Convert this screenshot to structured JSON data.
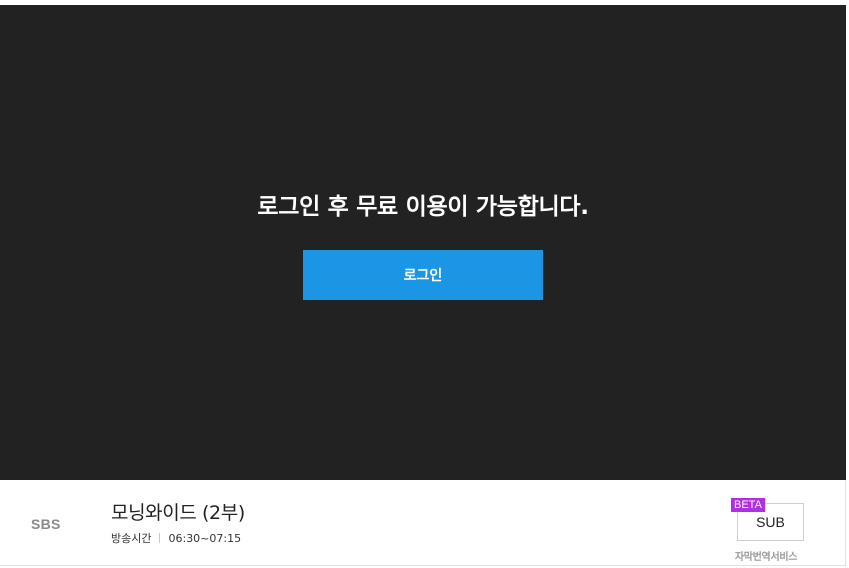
{
  "player": {
    "login_message": "로그인 후 무료 이용이 가능합니다.",
    "login_button_label": "로그인",
    "background_color": "#222222",
    "button_color": "#1b96e5"
  },
  "program": {
    "channel": "SBS",
    "title": "모닝와이드 (2부)",
    "airtime_label": "방송시간",
    "airtime_value": "06:30~07:15"
  },
  "subtitle_service": {
    "badge": "BETA",
    "button_label": "SUB",
    "caption": "자막번역서비스",
    "badge_color": "#b02fe3"
  }
}
